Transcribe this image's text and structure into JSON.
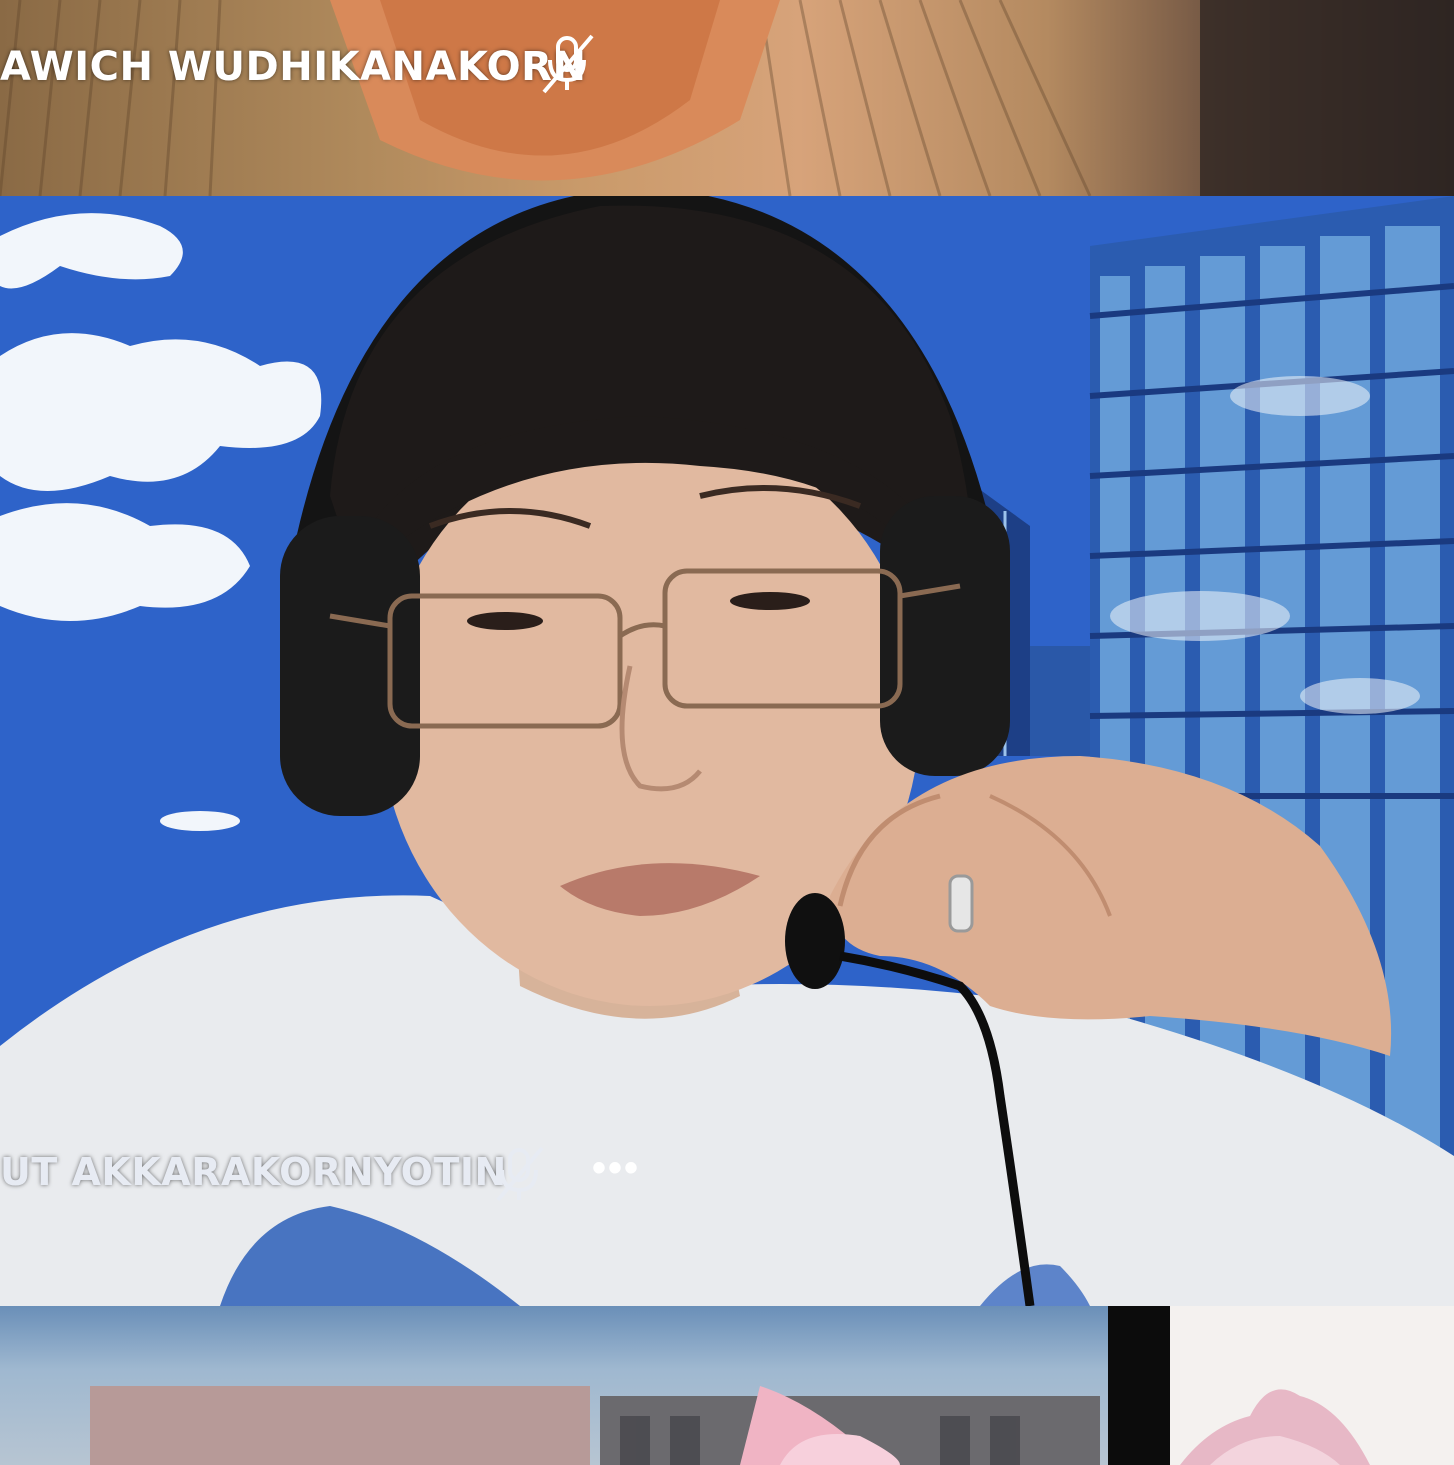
{
  "participants": [
    {
      "name": "AWICH WUDHIKANAKORN",
      "mic_icon": "mic-muted-icon"
    },
    {
      "name": "UT AKKARAKORNYOTIN",
      "mic_icon": "mic-muted-icon",
      "more_label": "•••"
    }
  ],
  "colors": {
    "name_text": "#ffffff",
    "virtual_background_sky": "#2e63c9"
  }
}
